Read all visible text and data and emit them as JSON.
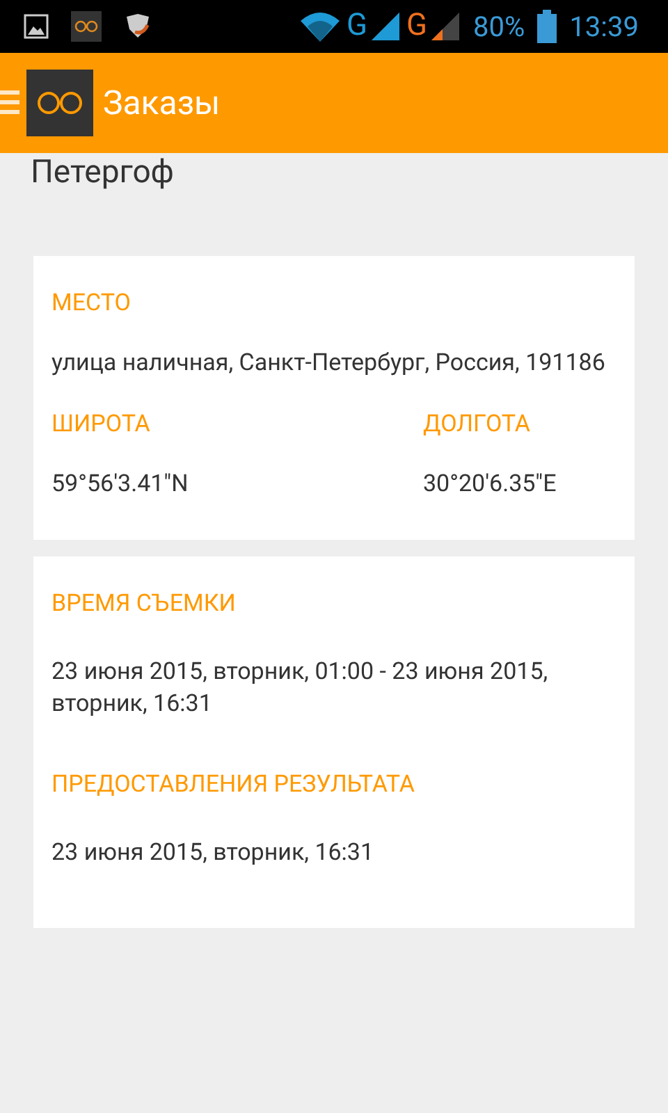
{
  "status_bar": {
    "networks": [
      {
        "label": "G",
        "color": "#1e9ad6"
      },
      {
        "label": "G",
        "color": "#f0701e"
      }
    ],
    "battery": "80%",
    "time": "13:39"
  },
  "app_bar": {
    "title": "Заказы"
  },
  "page_title": "Петергоф",
  "cards": [
    {
      "sections": [
        {
          "kind": "full",
          "fields": [
            {
              "label": "МЕСТО",
              "value": "улица наличная, Санкт-Петербург, Россия, 191186"
            }
          ]
        },
        {
          "kind": "pair",
          "fields": [
            {
              "label": "ШИРОТА",
              "value": "59°56'3.41\"N"
            },
            {
              "label": "ДОЛГОТА",
              "value": "30°20'6.35\"E"
            }
          ]
        }
      ]
    },
    {
      "sections": [
        {
          "kind": "full",
          "fields": [
            {
              "label": "ВРЕМЯ СЪЕМКИ",
              "value": "23 июня 2015, вторник, 01:00 - 23 июня 2015, вторник, 16:31"
            }
          ]
        },
        {
          "kind": "full",
          "fields": [
            {
              "label": "ПРЕДОСТАВЛЕНИЯ РЕЗУЛЬТАТА",
              "value": "23 июня 2015, вторник, 16:31"
            }
          ]
        }
      ]
    }
  ]
}
